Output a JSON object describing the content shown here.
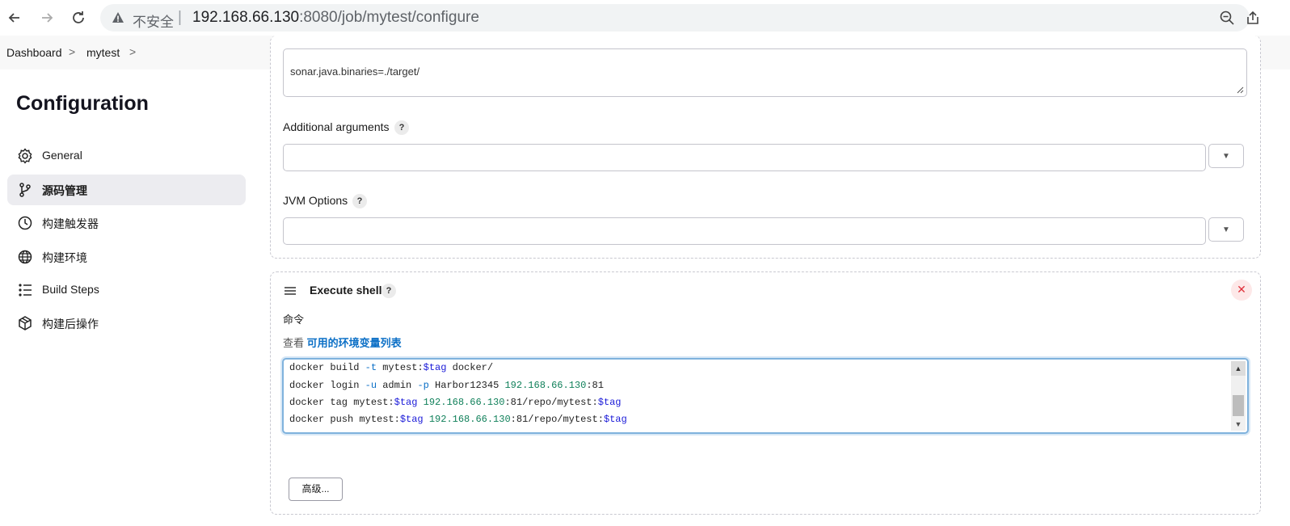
{
  "browser": {
    "insecure_label": "不安全",
    "separator": "|",
    "url_host": "192.168.66.130",
    "url_rest": ":8080/job/mytest/configure"
  },
  "breadcrumb": {
    "items": [
      "Dashboard",
      "mytest"
    ],
    "separator": ">"
  },
  "sidebar": {
    "title": "Configuration",
    "items": [
      {
        "label": "General",
        "icon": "gear-icon"
      },
      {
        "label": "源码管理",
        "icon": "git-branch-icon",
        "active": true
      },
      {
        "label": "构建触发器",
        "icon": "clock-icon"
      },
      {
        "label": "构建环境",
        "icon": "globe-icon"
      },
      {
        "label": "Build Steps",
        "icon": "list-icon"
      },
      {
        "label": "构建后操作",
        "icon": "package-icon"
      }
    ]
  },
  "sonar": {
    "properties_line": "sonar.java.binaries=./target/",
    "additional_arguments_label": "Additional arguments",
    "additional_arguments_value": "",
    "jvm_options_label": "JVM Options",
    "jvm_options_value": "",
    "help": "?"
  },
  "execute_shell": {
    "title": "Execute shell",
    "help": "?",
    "close": "✕",
    "command_label": "命令",
    "env_prefix": "查看",
    "env_link": "可用的环境变量列表",
    "advanced_button": "高级..."
  },
  "code": {
    "l1": {
      "a": "docker build ",
      "b": "-t",
      "c": " mytest:",
      "d": "$tag",
      "e": " docker/"
    },
    "l2": {
      "a": "docker login ",
      "b": "-u",
      "c": " admin ",
      "d": "-p",
      "e": " Harbor12345 ",
      "f": "192.168.66.130",
      "g": ":81"
    },
    "l3": {
      "a": "docker tag mytest:",
      "b": "$tag",
      "c": " ",
      "d": "192.168.66.130",
      "e": ":81/repo/mytest:",
      "f": "$tag"
    },
    "l4": {
      "a": "docker push mytest:",
      "b": "$tag",
      "c": " ",
      "d": "192.168.66.130",
      "e": ":81/repo/mytest:",
      "f": "$tag"
    }
  },
  "colors": {
    "link": "#0b6fc6",
    "close": "#e0323c",
    "active_nav_bg": "#ececf0"
  }
}
